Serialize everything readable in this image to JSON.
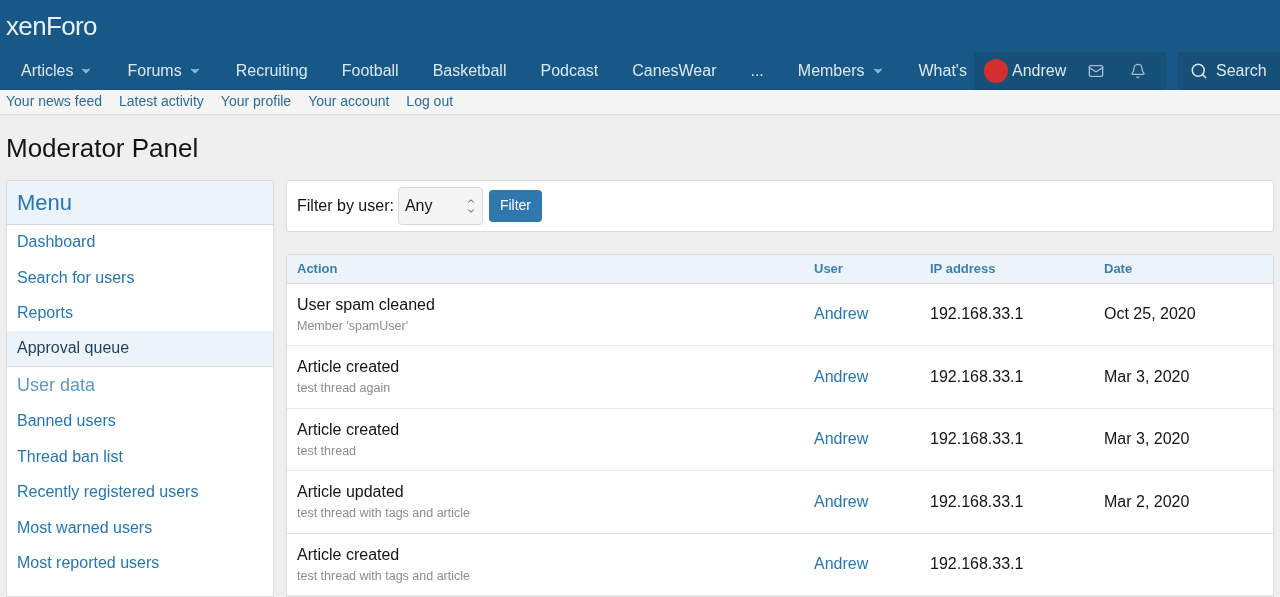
{
  "logo": {
    "text": "xenForo"
  },
  "nav": {
    "items": [
      {
        "label": "Articles",
        "has_menu": true
      },
      {
        "label": "Forums",
        "has_menu": true
      },
      {
        "label": "Recruiting",
        "has_menu": false
      },
      {
        "label": "Football",
        "has_menu": false
      },
      {
        "label": "Basketball",
        "has_menu": false
      },
      {
        "label": "Podcast",
        "has_menu": false
      },
      {
        "label": "CanesWear",
        "has_menu": false
      },
      {
        "label": "...",
        "has_menu": false
      },
      {
        "label": "Members",
        "has_menu": true
      },
      {
        "label": "What's",
        "has_menu": false
      }
    ],
    "user": "Andrew",
    "search": "Search"
  },
  "subnav": [
    "Your news feed",
    "Latest activity",
    "Your profile",
    "Your account",
    "Log out"
  ],
  "page_title": "Moderator Panel",
  "sidebar": {
    "title": "Menu",
    "items": [
      {
        "kind": "link",
        "label": "Dashboard",
        "selected": false
      },
      {
        "kind": "link",
        "label": "Search for users",
        "selected": false
      },
      {
        "kind": "link",
        "label": "Reports",
        "selected": false
      },
      {
        "kind": "link",
        "label": "Approval queue",
        "selected": true
      },
      {
        "kind": "heading",
        "label": "User data",
        "selected": false
      },
      {
        "kind": "link",
        "label": "Banned users",
        "selected": false
      },
      {
        "kind": "link",
        "label": "Thread ban list",
        "selected": false
      },
      {
        "kind": "link",
        "label": "Recently registered users",
        "selected": false
      },
      {
        "kind": "link",
        "label": "Most warned users",
        "selected": false
      },
      {
        "kind": "link",
        "label": "Most reported users",
        "selected": false
      }
    ]
  },
  "filter": {
    "label": "Filter by user:",
    "value": "Any",
    "button": "Filter"
  },
  "table": {
    "columns": [
      "Action",
      "User",
      "IP address",
      "Date"
    ],
    "rows": [
      {
        "action": "User spam cleaned",
        "detail": "Member 'spamUser'",
        "user": "Andrew",
        "ip": "192.168.33.1",
        "date": "Oct 25, 2020"
      },
      {
        "action": "Article created",
        "detail": "test thread again",
        "user": "Andrew",
        "ip": "192.168.33.1",
        "date": "Mar 3, 2020"
      },
      {
        "action": "Article created",
        "detail": "test thread",
        "user": "Andrew",
        "ip": "192.168.33.1",
        "date": "Mar 3, 2020"
      },
      {
        "action": "Article updated",
        "detail": "test thread with tags and article",
        "user": "Andrew",
        "ip": "192.168.33.1",
        "date": "Mar 2, 2020"
      },
      {
        "action": "Article created",
        "detail": "test thread with tags and article",
        "user": "Andrew",
        "ip": "192.168.33.1"
      }
    ]
  }
}
